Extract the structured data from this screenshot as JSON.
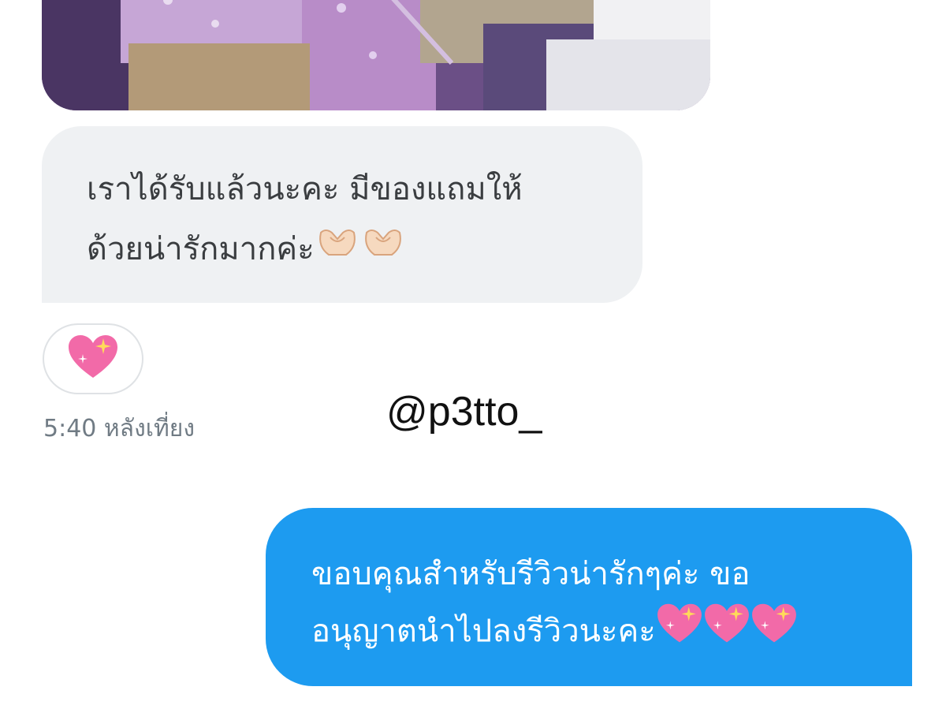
{
  "conversation": {
    "attachment": {
      "type": "photo",
      "icon": "photo-attachment"
    },
    "incoming_message": {
      "line1": "เราได้รับแล้วนะคะ มีของแถมให้",
      "line2": "ด้วยน่ารักมากค่ะ",
      "emoji": [
        "heart-hands-icon",
        "heart-hands-icon"
      ]
    },
    "reaction": {
      "emoji": "sparkling-heart-icon"
    },
    "timestamp": "5:40 หลังเที่ยง",
    "outgoing_message": {
      "line1": "ขอบคุณสำหรับรีวิวน่ารักๆค่ะ ขอ",
      "line2": "อนุญาตนำไปลงรีวิวนะคะ",
      "emoji": [
        "sparkling-heart-icon",
        "sparkling-heart-icon",
        "sparkling-heart-icon"
      ]
    }
  },
  "watermark": {
    "handle": "@p3tto_"
  },
  "colors": {
    "incoming_bubble": "#eff1f3",
    "outgoing_bubble": "#1d9bf0",
    "timestamp": "#707b84"
  }
}
